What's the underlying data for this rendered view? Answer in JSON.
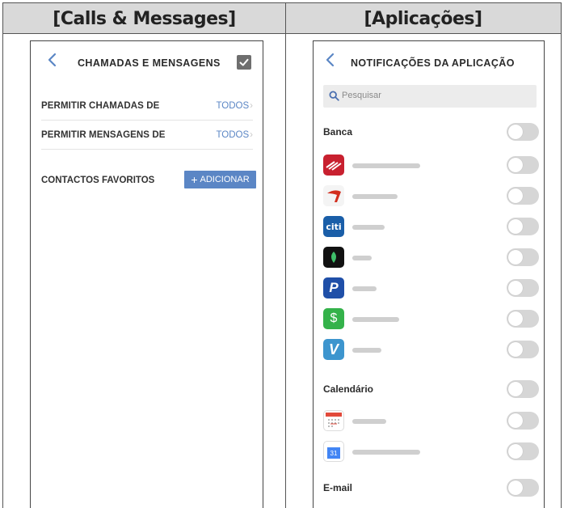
{
  "headers": {
    "left": "[Calls & Messages]",
    "right": "[Aplicações]"
  },
  "calls_screen": {
    "title": "CHAMADAS E MENSAGENS",
    "confirm_icon": "checkmark-icon",
    "rows": [
      {
        "label": "PERMITIR CHAMADAS DE",
        "value": "TODOS"
      },
      {
        "label": "PERMITIR MENSAGENS DE",
        "value": "TODOS"
      }
    ],
    "favorites_label": "CONTACTOS FAVORITOS",
    "add_button_label": "ADICIONAR",
    "add_button_icon": "+"
  },
  "apps_screen": {
    "title": "NOTIFICAÇÕES DA APLICAÇÃO",
    "search_placeholder": "Pesquisar",
    "sections": [
      {
        "label": "Banca",
        "toggle": "off"
      },
      {
        "label": "Calendário",
        "toggle": "off"
      },
      {
        "label": "E-mail",
        "toggle": "off"
      }
    ],
    "apps": [
      {
        "icon": "bank-of-america-icon",
        "color": "#c8202f",
        "toggle": "off"
      },
      {
        "icon": "capital-one-icon",
        "color": "#d22e1e",
        "toggle": "off"
      },
      {
        "icon": "citi-icon",
        "color": "#1a5ea8",
        "glyph": "citi",
        "toggle": "off"
      },
      {
        "icon": "mint-icon",
        "color": "#111111",
        "toggle": "off"
      },
      {
        "icon": "paypal-icon",
        "color": "#1f4fa8",
        "toggle": "off"
      },
      {
        "icon": "square-cash-icon",
        "color": "#34b24a",
        "glyph": "$",
        "toggle": "off"
      },
      {
        "icon": "venmo-icon",
        "color": "#3d95ce",
        "glyph": "V",
        "toggle": "off"
      },
      {
        "icon": "calendar-icon",
        "color": "#ffffff",
        "toggle": "off"
      },
      {
        "icon": "google-calendar-icon",
        "color": "#ffffff",
        "glyph": "31",
        "toggle": "off"
      }
    ]
  },
  "colors": {
    "accent": "#5b86c5",
    "toggle_off": "#d6d6d6",
    "header_bg": "#d9d9d9"
  }
}
